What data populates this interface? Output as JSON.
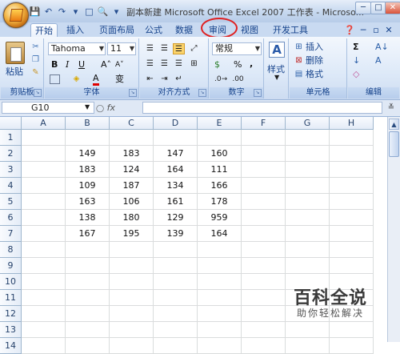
{
  "window": {
    "title": "副本新建 Microsoft Office Excel 2007 工作表 - Microso...",
    "controls": [
      "─",
      "□",
      "✕"
    ]
  },
  "quick_access": [
    "💾",
    "↶",
    "↷",
    "▾",
    "□",
    "🔍",
    "▾"
  ],
  "tabs": [
    "开始",
    "插入",
    "页面布局",
    "公式",
    "数据",
    "审阅",
    "视图",
    "开发工具"
  ],
  "ribbon_right_icons": [
    "❓",
    "─",
    "▫",
    "✕"
  ],
  "ribbon": {
    "clipboard": {
      "label": "剪贴板",
      "paste_label": "粘贴"
    },
    "font": {
      "label": "字体",
      "font_name": "Tahoma",
      "font_size": "11",
      "bold": "B",
      "italic": "I",
      "underline": "U",
      "grow": "A˄",
      "shrink": "A˅",
      "color_a": "A",
      "phonetic": "变"
    },
    "alignment": {
      "label": "对齐方式"
    },
    "number": {
      "label": "数字",
      "format": "常规",
      "percent": "%",
      "comma": ",",
      "currency": "$"
    },
    "styles": {
      "label": "样式",
      "icon": "A"
    },
    "cells": {
      "label": "单元格",
      "insert": "插入",
      "delete": "删除",
      "format": "格式"
    },
    "editing": {
      "label": "编辑",
      "sum": "Σ",
      "sort": "A↓",
      "fill": "↓",
      "find": "A",
      "clear": "◇"
    }
  },
  "formula_bar": {
    "name_box": "G10",
    "fx": "fx",
    "value": ""
  },
  "sheet": {
    "columns": [
      "A",
      "B",
      "C",
      "D",
      "E",
      "F",
      "G",
      "H"
    ],
    "rows": [
      "1",
      "2",
      "3",
      "4",
      "5",
      "6",
      "7",
      "8",
      "9",
      "10",
      "11",
      "12",
      "13",
      "14"
    ],
    "data": [
      [
        "",
        "",
        "",
        "",
        "",
        "",
        "",
        ""
      ],
      [
        "",
        "149",
        "183",
        "147",
        "160",
        "",
        "",
        ""
      ],
      [
        "",
        "183",
        "124",
        "164",
        "111",
        "",
        "",
        ""
      ],
      [
        "",
        "109",
        "187",
        "134",
        "166",
        "",
        "",
        ""
      ],
      [
        "",
        "163",
        "106",
        "161",
        "178",
        "",
        "",
        ""
      ],
      [
        "",
        "138",
        "180",
        "129",
        "959",
        "",
        "",
        ""
      ],
      [
        "",
        "167",
        "195",
        "139",
        "164",
        "",
        "",
        ""
      ],
      [
        "",
        "",
        "",
        "",
        "",
        "",
        "",
        ""
      ],
      [
        "",
        "",
        "",
        "",
        "",
        "",
        "",
        ""
      ],
      [
        "",
        "",
        "",
        "",
        "",
        "",
        "",
        ""
      ],
      [
        "",
        "",
        "",
        "",
        "",
        "",
        "",
        ""
      ],
      [
        "",
        "",
        "",
        "",
        "",
        "",
        "",
        ""
      ],
      [
        "",
        "",
        "",
        "",
        "",
        "",
        "",
        ""
      ],
      [
        "",
        "",
        "",
        "",
        "",
        "",
        "",
        ""
      ]
    ]
  },
  "watermark": {
    "title": "百科全说",
    "subtitle": "助你轻松解决"
  },
  "colors": {
    "highlight_circle": "#e02020",
    "ribbon_label": "#15428b"
  }
}
